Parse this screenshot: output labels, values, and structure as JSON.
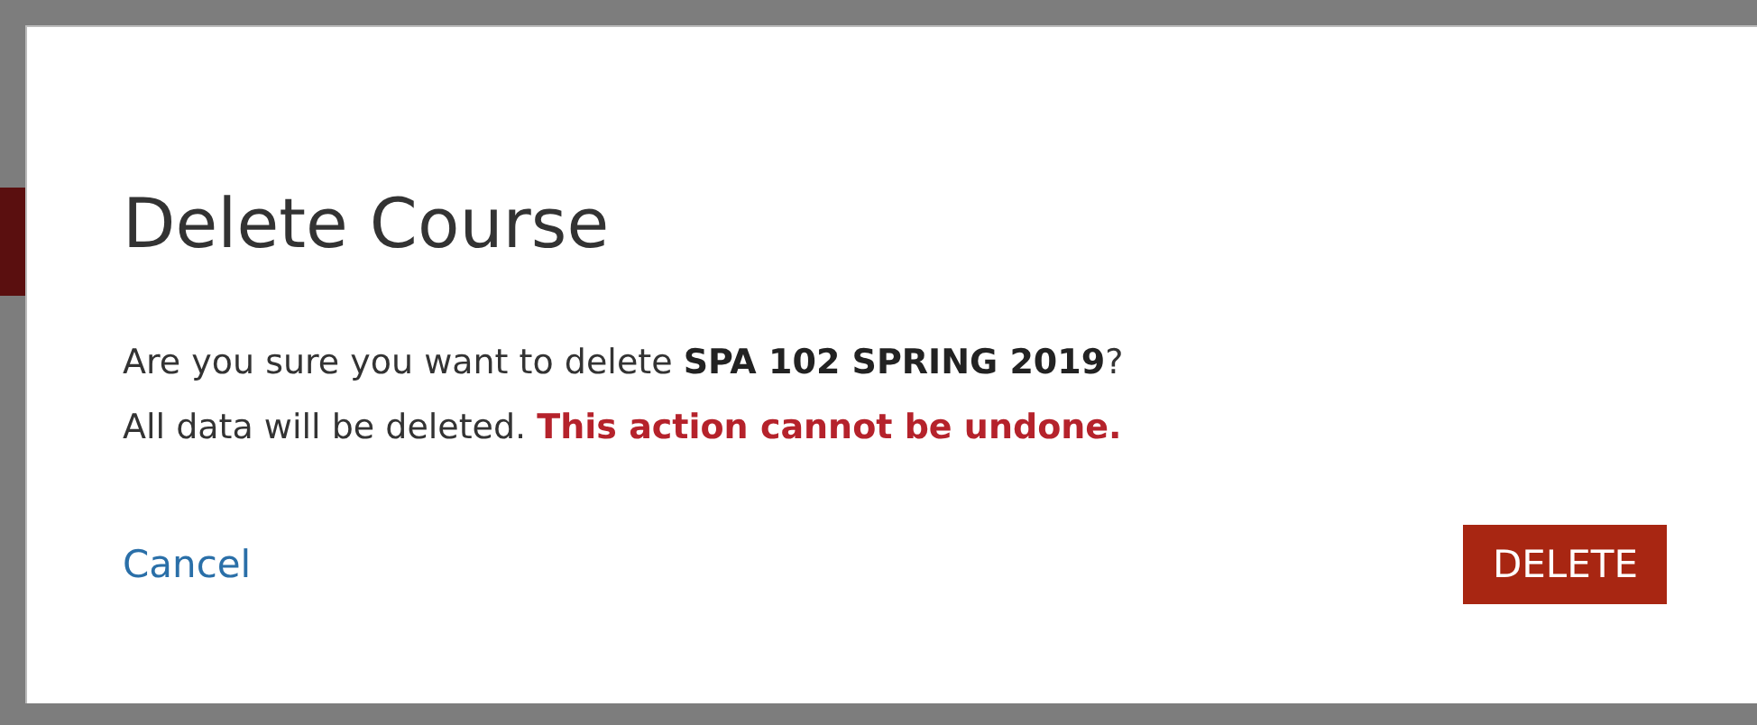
{
  "dialog": {
    "title": "Delete Course",
    "message": [
      {
        "kind": "question",
        "text": "Are you sure you want to delete **SPA 102 SPRING 2019**?"
      },
      {
        "kind": "warning",
        "text": "All data will be deleted. **This action cannot be undone.**"
      }
    ],
    "cancel": "Cancel",
    "confirm": "DELETE"
  }
}
